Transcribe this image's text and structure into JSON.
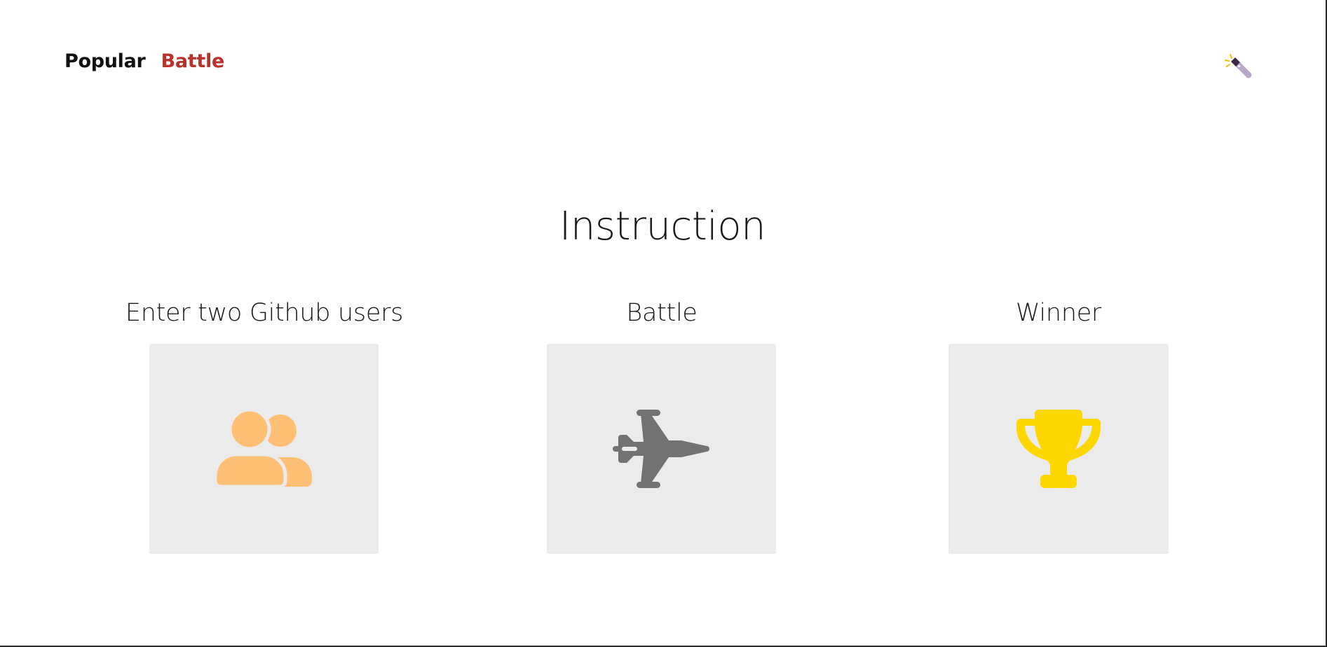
{
  "nav": {
    "popular_label": "Popular",
    "battle_label": "Battle"
  },
  "theme_toggle": {
    "icon": "flashlight-icon"
  },
  "instruction": {
    "title": "Instruction",
    "steps": [
      {
        "label": "Enter two Github users",
        "icon": "users-icon",
        "icon_color": "#ffbf74"
      },
      {
        "label": "Battle",
        "icon": "fighter-jet-icon",
        "icon_color": "#727272"
      },
      {
        "label": "Winner",
        "icon": "trophy-icon",
        "icon_color": "#ffd700"
      }
    ]
  },
  "colors": {
    "battle_accent": "#b7322a",
    "box_background": "#ebebeb"
  }
}
